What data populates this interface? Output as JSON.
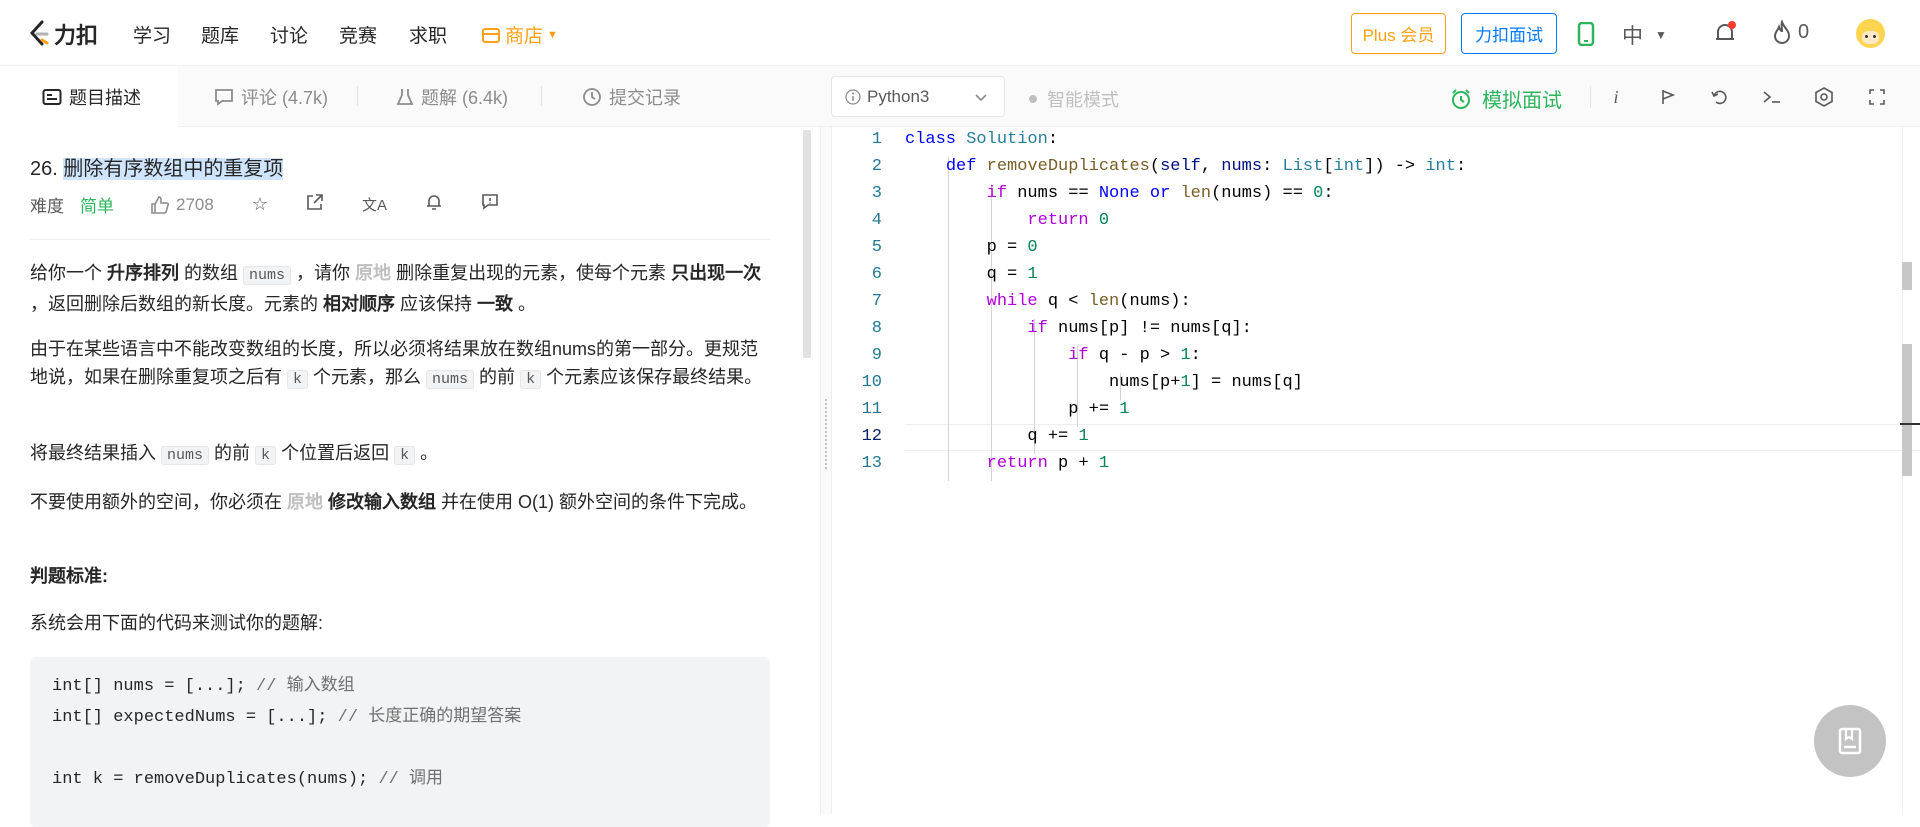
{
  "brand": {
    "name": "力扣"
  },
  "nav": {
    "items": [
      "学习",
      "题库",
      "讨论",
      "竞赛",
      "求职"
    ],
    "shop": "商店"
  },
  "header": {
    "plus": "Plus 会员",
    "interview": "力扣面试",
    "lang": "中",
    "streak": "0"
  },
  "tabs": [
    {
      "label": "题目描述"
    },
    {
      "label": "评论 (4.7k)"
    },
    {
      "label": "题解 (6.4k)"
    },
    {
      "label": "提交记录"
    }
  ],
  "editor_toolbar": {
    "language": "Python3",
    "smart_mode": "智能模式",
    "mock_interview": "模拟面试"
  },
  "problem": {
    "number": "26. ",
    "title": "删除有序数组中的重复项",
    "difficulty_label": "难度",
    "difficulty": "简单",
    "likes": "2708"
  },
  "description": {
    "p1": {
      "a": "给你一个 ",
      "b": "升序排列",
      "c": " 的数组 ",
      "code1": "nums",
      "d": " ，请你 ",
      "e": "原地",
      "f": " 删除重复出现的元素，使每个元素 ",
      "g": "只出现一次",
      "h": " ，返回删除后数组的新长度。元素的 ",
      "i": "相对顺序",
      "j": " 应该保持 ",
      "k": "一致",
      "l": " 。"
    },
    "p2": {
      "a": "由于在某些语言中不能改变数组的长度，所以必须将结果放在数组nums的第一部分。更规范地说，如果在删除重复项之后有 ",
      "c1": "k",
      "b": " 个元素，那么 ",
      "c2": "nums",
      "c": " 的前 ",
      "c3": "k",
      "d": " 个元素应该保存最终结果。"
    },
    "p3": {
      "a": "将最终结果插入 ",
      "c1": "nums",
      "b": " 的前 ",
      "c2": "k",
      "c": " 个位置后返回 ",
      "c3": "k",
      "d": " 。"
    },
    "p4": {
      "a": "不要使用额外的空间，你必须在 ",
      "b": "原地",
      "c": " ",
      "d": "修改输入数组",
      "e": " 并在使用 O(1) 额外空间的条件下完成。"
    },
    "judge_title": "判题标准:",
    "p5": "系统会用下面的代码来测试你的题解:"
  },
  "snippet": [
    {
      "code": "int[] nums = [...]; ",
      "comment": "// 输入数组"
    },
    {
      "code": "int[] expectedNums = [...]; ",
      "comment": "// 长度正确的期望答案"
    },
    {
      "code": "",
      "comment": ""
    },
    {
      "code": "int k = removeDuplicates(nums); ",
      "comment": "// 调用"
    }
  ],
  "editor": {
    "line_numbers": [
      "1",
      "2",
      "3",
      "4",
      "5",
      "6",
      "7",
      "8",
      "9",
      "10",
      "11",
      "12",
      "13"
    ],
    "current_line": "12"
  },
  "colors": {
    "accent": "#ffa116",
    "easy": "#2db55d",
    "link": "#007aff"
  }
}
